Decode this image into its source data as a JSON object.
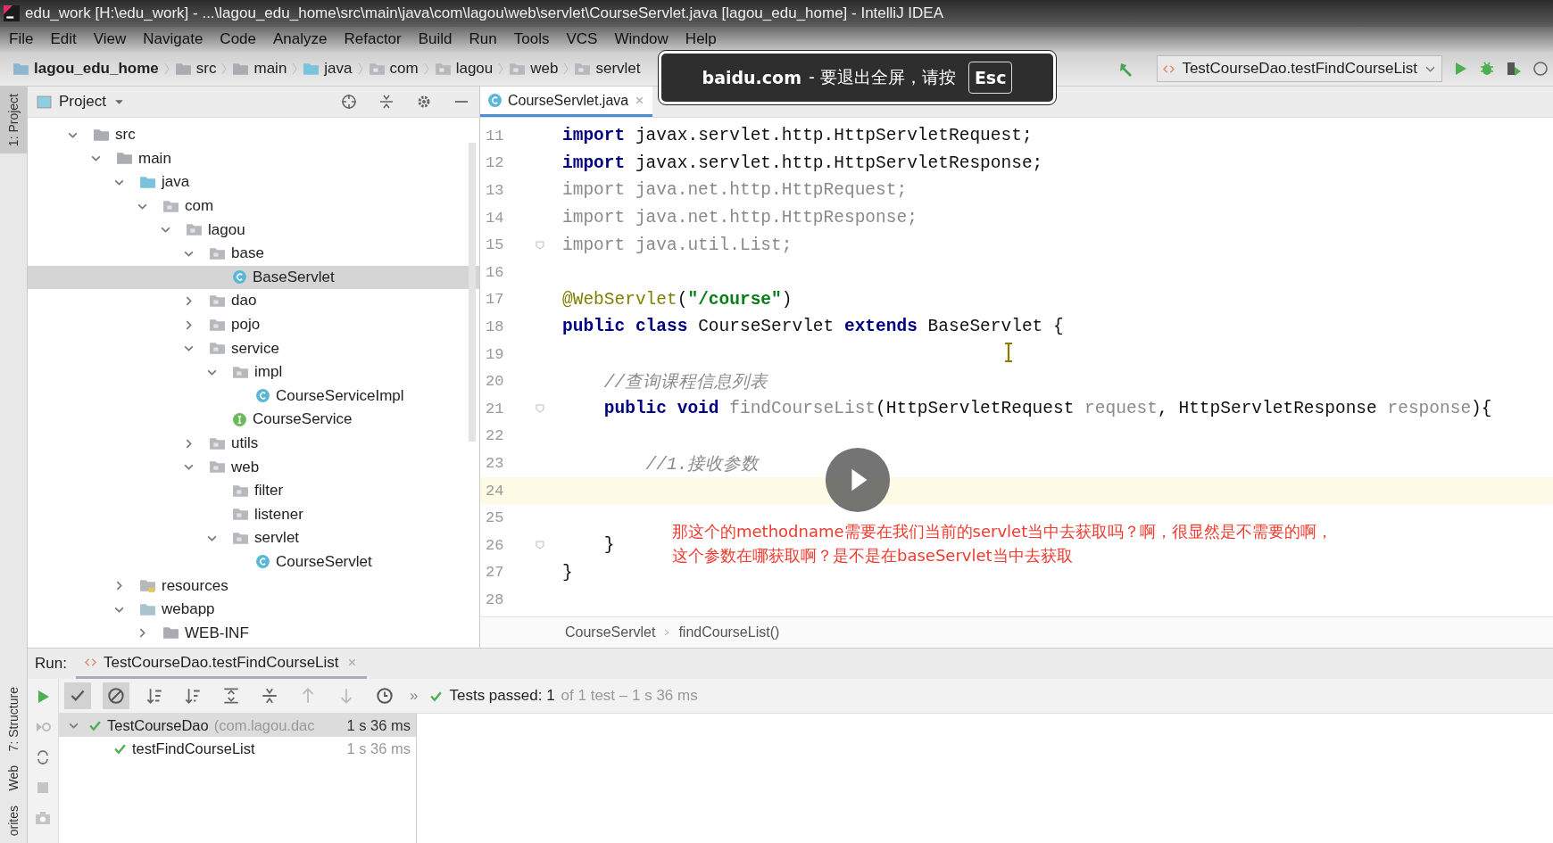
{
  "window": {
    "title": "edu_work [H:\\edu_work] - ...\\lagou_edu_home\\src\\main\\java\\com\\lagou\\web\\servlet\\CourseServlet.java [lagou_edu_home] - IntelliJ IDEA"
  },
  "menu": [
    "File",
    "Edit",
    "View",
    "Navigate",
    "Code",
    "Analyze",
    "Refactor",
    "Build",
    "Run",
    "Tools",
    "VCS",
    "Window",
    "Help"
  ],
  "nav_bar": [
    {
      "label": "lagou_edu_home",
      "kind": "module"
    },
    {
      "label": "src",
      "kind": "folder"
    },
    {
      "label": "main",
      "kind": "folder"
    },
    {
      "label": "java",
      "kind": "source"
    },
    {
      "label": "com",
      "kind": "package"
    },
    {
      "label": "lagou",
      "kind": "package"
    },
    {
      "label": "web",
      "kind": "package"
    },
    {
      "label": "servlet",
      "kind": "package"
    }
  ],
  "run_config": {
    "label": "TestCourseDao.testFindCourseList"
  },
  "fullscreen_notice": {
    "site": "baidu.com",
    "message": "- 要退出全屏，请按",
    "key": "Esc"
  },
  "side_strip": {
    "top": [
      {
        "label": "1: Project",
        "selected": true
      }
    ],
    "bottom": [
      {
        "label": "7: Structure",
        "selected": false
      },
      {
        "label": "Web",
        "selected": false
      },
      {
        "label": "orites",
        "selected": false
      }
    ]
  },
  "project_panel": {
    "title": "Project",
    "tree": [
      {
        "label": "src",
        "kind": "folder",
        "expanded": true,
        "selected": false,
        "children": [
          {
            "label": "main",
            "kind": "folder",
            "expanded": true,
            "selected": false,
            "children": [
              {
                "label": "java",
                "kind": "source",
                "expanded": true,
                "selected": false,
                "children": [
                  {
                    "label": "com",
                    "kind": "package",
                    "expanded": true,
                    "selected": false,
                    "children": [
                      {
                        "label": "lagou",
                        "kind": "package",
                        "expanded": true,
                        "selected": false,
                        "children": [
                          {
                            "label": "base",
                            "kind": "package",
                            "expanded": true,
                            "selected": false,
                            "children": [
                              {
                                "label": "BaseServlet",
                                "kind": "class",
                                "selected": true
                              }
                            ]
                          },
                          {
                            "label": "dao",
                            "kind": "package",
                            "expanded": false,
                            "selected": false
                          },
                          {
                            "label": "pojo",
                            "kind": "package",
                            "expanded": false,
                            "selected": false
                          },
                          {
                            "label": "service",
                            "kind": "package",
                            "expanded": true,
                            "selected": false,
                            "children": [
                              {
                                "label": "impl",
                                "kind": "package",
                                "expanded": true,
                                "selected": false,
                                "children": [
                                  {
                                    "label": "CourseServiceImpl",
                                    "kind": "class",
                                    "selected": false
                                  }
                                ]
                              },
                              {
                                "label": "CourseService",
                                "kind": "interface",
                                "selected": false
                              }
                            ]
                          },
                          {
                            "label": "utils",
                            "kind": "package",
                            "expanded": false,
                            "selected": false
                          },
                          {
                            "label": "web",
                            "kind": "package",
                            "expanded": true,
                            "selected": false,
                            "children": [
                              {
                                "label": "filter",
                                "kind": "package",
                                "selected": false
                              },
                              {
                                "label": "listener",
                                "kind": "package",
                                "selected": false
                              },
                              {
                                "label": "servlet",
                                "kind": "package",
                                "expanded": true,
                                "selected": false,
                                "children": [
                                  {
                                    "label": "CourseServlet",
                                    "kind": "class",
                                    "selected": false
                                  }
                                ]
                              }
                            ]
                          }
                        ]
                      }
                    ]
                  }
                ]
              },
              {
                "label": "resources",
                "kind": "resources",
                "expanded": false,
                "selected": false
              },
              {
                "label": "webapp",
                "kind": "web",
                "expanded": true,
                "selected": false,
                "children": [
                  {
                    "label": "WEB-INF",
                    "kind": "folder",
                    "expanded": false,
                    "selected": false
                  }
                ]
              }
            ]
          }
        ]
      }
    ]
  },
  "editor": {
    "tabs": [
      {
        "label": "CourseServlet.java",
        "selected": true
      }
    ],
    "lines": [
      {
        "number": "11",
        "tokens": [
          {
            "kind": "kw",
            "text": "import"
          },
          {
            "kind": "plain",
            "text": " javax.servlet.http.HttpServletRequest;"
          }
        ]
      },
      {
        "number": "12",
        "tokens": [
          {
            "kind": "kw",
            "text": "import"
          },
          {
            "kind": "plain",
            "text": " javax.servlet.http.HttpServletResponse;"
          }
        ]
      },
      {
        "number": "13",
        "tokens": [
          {
            "kind": "dim",
            "text": "import java.net.http.HttpRequest;"
          }
        ]
      },
      {
        "number": "14",
        "tokens": [
          {
            "kind": "dim",
            "text": "import java.net.http.HttpResponse;"
          }
        ]
      },
      {
        "number": "15",
        "fold": true,
        "tokens": [
          {
            "kind": "dim",
            "text": "import java.util.List;"
          }
        ]
      },
      {
        "number": "16"
      },
      {
        "number": "17",
        "tokens": [
          {
            "kind": "ann",
            "text": "@WebServlet"
          },
          {
            "kind": "plain",
            "text": "("
          },
          {
            "kind": "str",
            "text": "\"/course\""
          },
          {
            "kind": "plain",
            "text": ")"
          }
        ]
      },
      {
        "number": "18",
        "tokens": [
          {
            "kind": "kw",
            "text": "public class"
          },
          {
            "kind": "plain",
            "text": " CourseServlet "
          },
          {
            "kind": "kw",
            "text": "extends"
          },
          {
            "kind": "plain",
            "text": " BaseServlet {"
          }
        ]
      },
      {
        "number": "19"
      },
      {
        "number": "20",
        "tokens": [
          {
            "kind": "cmt",
            "text": "    //查询课程信息列表"
          }
        ]
      },
      {
        "number": "21",
        "fold": true,
        "tokens": [
          {
            "kind": "kw",
            "text": "    public void "
          },
          {
            "kind": "dim",
            "text": "findCourseList"
          },
          {
            "kind": "plain",
            "text": "(HttpServletRequest "
          },
          {
            "kind": "dim",
            "text": "request"
          },
          {
            "kind": "plain",
            "text": ", HttpServletResponse "
          },
          {
            "kind": "dim",
            "text": "response"
          },
          {
            "kind": "plain",
            "text": "){"
          }
        ]
      },
      {
        "number": "22"
      },
      {
        "number": "23",
        "tokens": [
          {
            "kind": "cmt",
            "text": "        //1.接收参数"
          }
        ]
      },
      {
        "number": "24",
        "current": true
      },
      {
        "number": "25"
      },
      {
        "number": "26",
        "fold": true,
        "tokens": [
          {
            "kind": "plain",
            "text": "    }"
          }
        ]
      },
      {
        "number": "27",
        "tokens": [
          {
            "kind": "plain",
            "text": "}"
          }
        ]
      },
      {
        "number": "28"
      }
    ],
    "breadcrumbs": [
      "CourseServlet",
      "findCourseList()"
    ]
  },
  "subtitle": [
    "那这个的methodname需要在我们当前的servlet当中去获取吗？啊，很显然是不需要的啊，",
    "这个参数在哪获取啊？是不是在baseServlet当中去获取"
  ],
  "run_panel": {
    "label": "Run:",
    "tab": "TestCourseDao.testFindCourseList",
    "more": "»",
    "status": {
      "passed": "Tests passed: 1",
      "detail": "of 1 test – 1 s 36 ms"
    },
    "tests": [
      {
        "name": "TestCourseDao",
        "package": "(com.lagou.dac",
        "time": "1 s 36 ms",
        "passed": true,
        "selected": true,
        "expanded": true,
        "children": [
          {
            "name": "testFindCourseList",
            "time": "1 s 36 ms",
            "passed": true,
            "selected": false
          }
        ]
      }
    ]
  }
}
